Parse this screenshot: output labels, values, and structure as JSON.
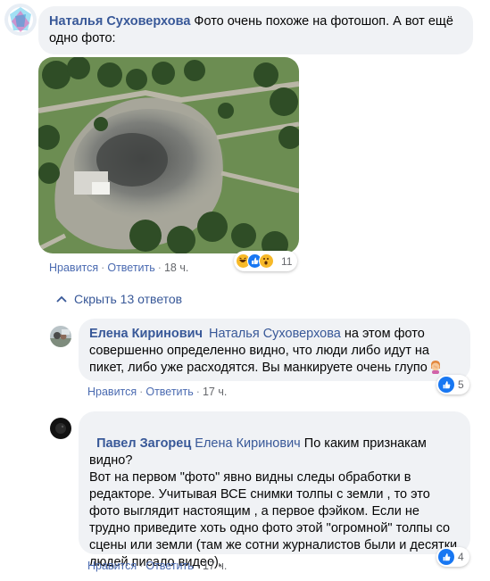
{
  "comment1": {
    "author": "Наталья Суховерхова",
    "text": "Фото очень похоже на фотошоп. А вот ещё одно фото:",
    "actions": {
      "like": "Нравится",
      "reply": "Ответить",
      "time": "18 ч."
    },
    "reactions": {
      "count": "11",
      "types": [
        "haha-icon",
        "like-icon",
        "wow-icon"
      ]
    }
  },
  "replies_toggle": {
    "label": "Скрыть 13 ответов",
    "icon": "chevron-up-icon"
  },
  "reply1": {
    "author": "Елена Киринович",
    "mention": "Наталья Суховерхова",
    "text": "на этом фото совершенно определенно видно, что люди либо идут на пикет, либо уже расходятся. Вы манкируете очень глупо",
    "emoji": "facepalm-emoji",
    "actions": {
      "like": "Нравится",
      "reply": "Ответить",
      "time": "17 ч."
    },
    "reactions": {
      "count": "5",
      "types": [
        "like-icon"
      ]
    }
  },
  "reply2": {
    "author": "Павел Загорец",
    "mention": "Елена Киринович",
    "text": "По каким признакам видно?\nВот на первом \"фото\" явно видны следы обработки в редакторе. Учитывая ВСЕ снимки толпы с земли , то это фото выглядит настоящим , а первое фэйком. Если не трудно приведите хоть одно фото этой \"огромной\" толпы со сцены или земли (там же сотни журналистов были и десятки людей писало видео).",
    "actions": {
      "like": "Нравится",
      "reply": "Ответить",
      "time": "17 ч."
    },
    "reactions": {
      "count": "4",
      "types": [
        "like-icon"
      ]
    }
  },
  "colors": {
    "link": "#385898",
    "bubble": "#f0f2f5",
    "like_blue": "#1877f2"
  }
}
